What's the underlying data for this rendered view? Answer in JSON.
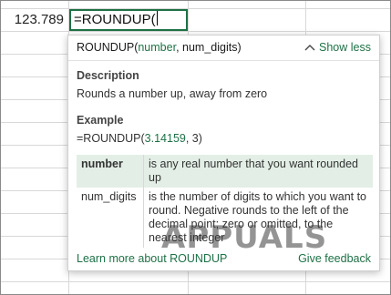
{
  "cell": {
    "value": "123.789",
    "formula": "=ROUNDUP("
  },
  "tooltip": {
    "signature_fn": "ROUNDUP(",
    "signature_active_arg": "number",
    "signature_rest": ", num_digits)",
    "show_less_label": "Show less",
    "description_title": "Description",
    "description_text": "Rounds a number up, away from zero",
    "example_title": "Example",
    "example_fn": "=ROUNDUP(",
    "example_arg1": "3.14159",
    "example_rest": ", 3)",
    "params": [
      {
        "name": "number",
        "desc": "is any real number that you want rounded up"
      },
      {
        "name": "num_digits",
        "desc": "is the number of digits to which you want to round. Negative rounds to the left of the decimal point; zero or omitted, to the nearest integer"
      }
    ],
    "learn_more_label": "Learn more about ROUNDUP",
    "feedback_label": "Give feedback"
  },
  "watermark": "APPUALS",
  "colors": {
    "accent": "#1e7145",
    "highlight_row": "#e3efe6"
  },
  "icons": {
    "show_less": "chevron-up-icon",
    "cursor": "text-cursor-icon"
  }
}
